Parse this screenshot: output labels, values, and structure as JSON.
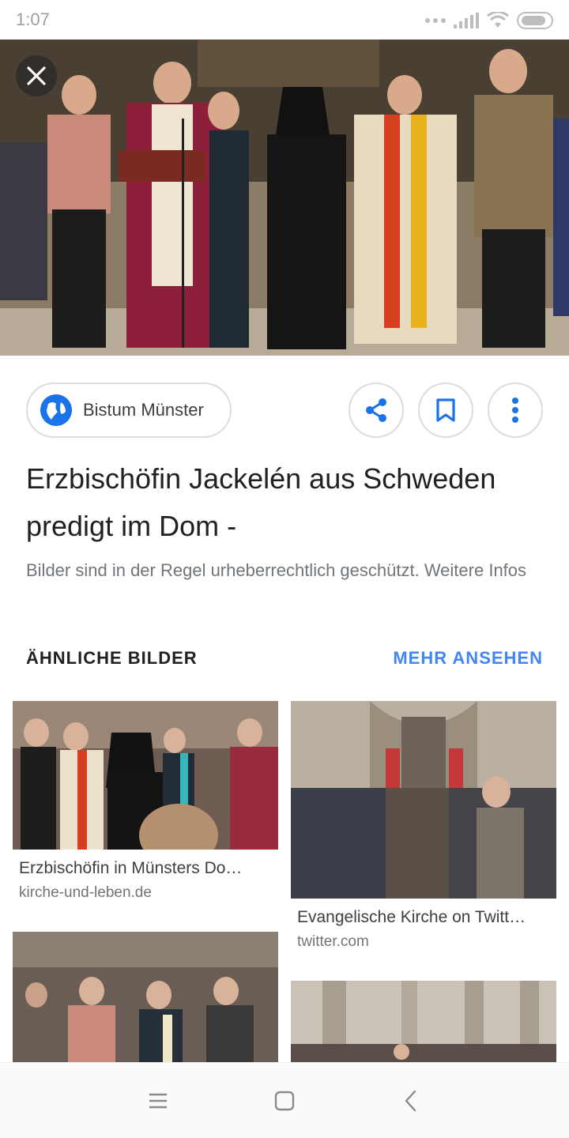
{
  "status_bar": {
    "time": "1:07"
  },
  "hero": {
    "close_icon": "close-icon"
  },
  "source": {
    "name": "Bistum Münster",
    "icon": "globe-icon"
  },
  "actions": {
    "share_icon": "share-icon",
    "bookmark_icon": "bookmark-icon",
    "more_icon": "more-vert-icon"
  },
  "result": {
    "title": "Erzbischöfin Jackelén aus Schweden predigt im Dom -",
    "notice": "Bilder sind in der Regel urheberrechtlich geschützt. Weitere Infos"
  },
  "related": {
    "heading": "ÄHNLICHE BILDER",
    "more_label": "MEHR ANSEHEN",
    "items": [
      {
        "title": "Erzbischöfin in Münsters Do…",
        "source": "kirche-und-leben.de"
      },
      {
        "title": "Evangelische Kirche on Twitt…",
        "source": "twitter.com"
      },
      {
        "title": "",
        "source": ""
      },
      {
        "title": "",
        "source": ""
      }
    ]
  },
  "colors": {
    "accent": "#4285f4",
    "text_primary": "#202124",
    "text_secondary": "#70757a",
    "border": "#dadce0"
  },
  "nav": {
    "menu_icon": "menu-icon",
    "home_icon": "square-icon",
    "back_icon": "back-icon"
  }
}
